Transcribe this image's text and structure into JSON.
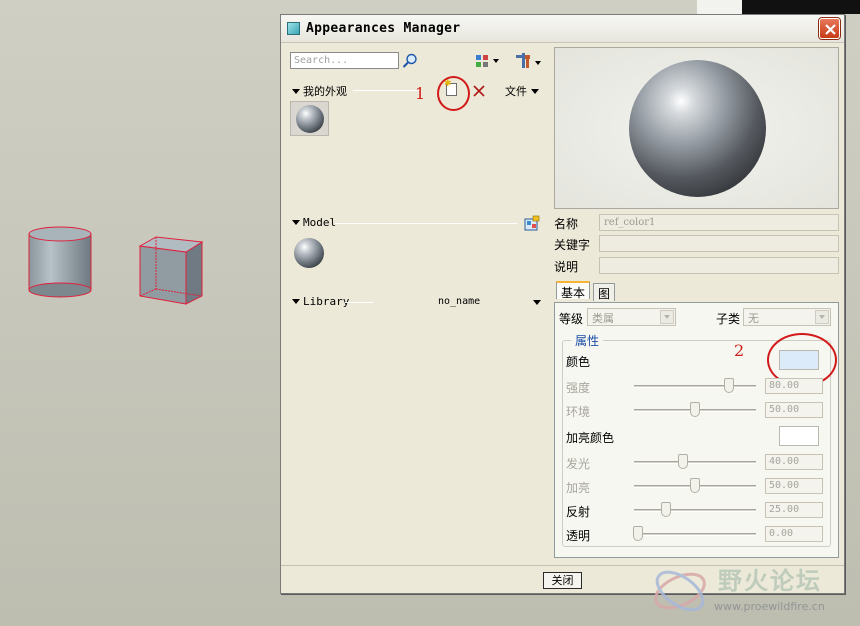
{
  "window": {
    "title": "Appearances Manager"
  },
  "left": {
    "search_placeholder": "Search...",
    "my_appearances": "我的外观",
    "file_menu": "文件",
    "model_section": "Model",
    "library_section": "Library",
    "library_value": "no_name"
  },
  "annotations": {
    "marker_1": "1",
    "marker_2": "2"
  },
  "fields": {
    "name_label": "名称",
    "name_value": "ref_color1",
    "keywords_label": "关键字",
    "description_label": "说明"
  },
  "tabs": {
    "basic": "基本",
    "map": "图"
  },
  "basic": {
    "level_label": "等级",
    "level_value": "类属",
    "subclass_label": "子类",
    "subclass_value": "无",
    "group_title": "属性"
  },
  "properties": {
    "color_label": "颜色",
    "intensity_label": "强度",
    "intensity_value": "80.00",
    "ambient_label": "环境",
    "ambient_value": "50.00",
    "highlight_color_label": "加亮颜色",
    "shine_label": "发光",
    "shine_value": "40.00",
    "highlight_label": "加亮",
    "highlight_value": "50.00",
    "reflection_label": "反射",
    "reflection_value": "25.00",
    "transparency_label": "透明",
    "transparency_value": "0.00"
  },
  "buttons": {
    "close": "关闭"
  },
  "watermark": {
    "title": "野火论坛",
    "url": "www.proewildfire.cn"
  },
  "colors": {
    "main_color": "#dcebfa",
    "highlight_color": "#ffffff",
    "annotation_red": "#d21a1a"
  }
}
